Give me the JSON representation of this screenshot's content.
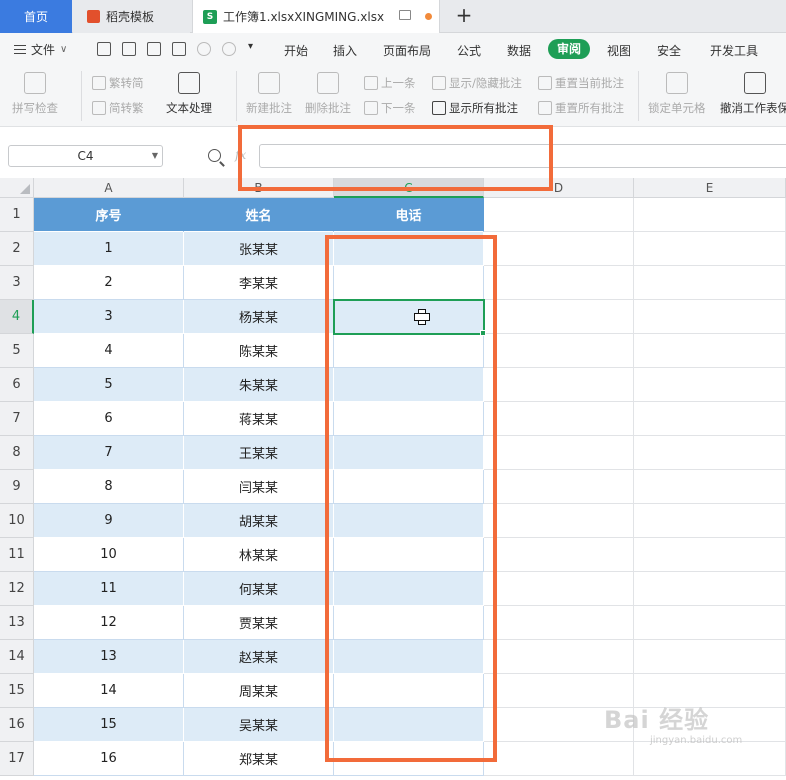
{
  "tabs": {
    "home": "首页",
    "template": "稻壳模板",
    "file": "工作簿1.xlsxXINGMING.xlsx",
    "new_tab": "+"
  },
  "menu": {
    "file": "文件",
    "items": [
      "开始",
      "插入",
      "页面布局",
      "公式",
      "数据",
      "审阅",
      "视图",
      "安全",
      "开发工具"
    ],
    "active": "审阅"
  },
  "ribbon": {
    "spell_check": "拼写检查",
    "trad_to_simp": "繁转简",
    "simp_to_trad": "简转繁",
    "text_process": "文本处理",
    "new_comment": "新建批注",
    "delete_comment": "删除批注",
    "prev": "上一条",
    "next": "下一条",
    "show_hide_comment": "显示/隐藏批注",
    "show_all_comments": "显示所有批注",
    "reset_current_comment": "重置当前批注",
    "reset_all_comments": "重置所有批注",
    "lock_cell": "锁定单元格",
    "unprotect_sheet": "撤消工作表保"
  },
  "formula_bar": {
    "name_box": "C4",
    "fx": "fx",
    "formula": ""
  },
  "sheet": {
    "columns": [
      "A",
      "B",
      "C",
      "D",
      "E"
    ],
    "rows": [
      "1",
      "2",
      "3",
      "4",
      "5",
      "6",
      "7",
      "8",
      "9",
      "10",
      "11",
      "12",
      "13",
      "14",
      "15",
      "16",
      "17"
    ],
    "headers": [
      "序号",
      "姓名",
      "电话"
    ],
    "data": [
      [
        "1",
        "张某某",
        ""
      ],
      [
        "2",
        "李某某",
        ""
      ],
      [
        "3",
        "杨某某",
        ""
      ],
      [
        "4",
        "陈某某",
        ""
      ],
      [
        "5",
        "朱某某",
        ""
      ],
      [
        "6",
        "蒋某某",
        ""
      ],
      [
        "7",
        "王某某",
        ""
      ],
      [
        "8",
        "闫某某",
        ""
      ],
      [
        "9",
        "胡某某",
        ""
      ],
      [
        "10",
        "林某某",
        ""
      ],
      [
        "11",
        "何某某",
        ""
      ],
      [
        "12",
        "贾某某",
        ""
      ],
      [
        "13",
        "赵某某",
        ""
      ],
      [
        "14",
        "周某某",
        ""
      ],
      [
        "15",
        "吴某某",
        ""
      ],
      [
        "16",
        "郑某某",
        ""
      ]
    ],
    "selected_cell": "C4"
  },
  "colors": {
    "header_fill": "#5b9bd5",
    "band_fill": "#ddebf7",
    "accent_green": "#1e9e56",
    "highlight_orange": "#f26b3a"
  },
  "watermark": {
    "main": "Bai 经验",
    "sub": "jingyan.baidu.com"
  }
}
